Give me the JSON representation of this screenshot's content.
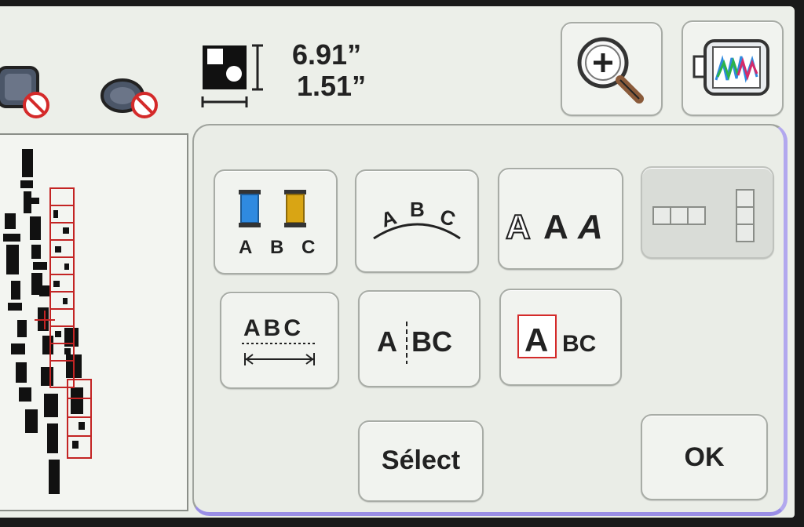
{
  "size": {
    "width": "6.91”",
    "height": "1.51”"
  },
  "buttons": {
    "select_label": "Sélect",
    "ok_label": "OK"
  },
  "icons": {
    "frame_no": "frame-no-icon",
    "oval_no": "oval-frame-no-icon",
    "size_indicator": "pattern-size-icon",
    "zoom": "zoom-in-icon",
    "embroidery": "embroidery-frame-icon",
    "thread_color": "thread-color-abc-icon",
    "arc_text": "arc-text-abc-icon",
    "font_style": "font-style-aaa-icon",
    "array": "array-layout-icon",
    "spacing": "letter-spacing-abc-icon",
    "split": "split-letters-abc-icon",
    "single_letter": "single-letter-abc-icon"
  },
  "colors": {
    "thread_blue": "#2f8ae0",
    "thread_gold": "#d9a514",
    "accent_red": "#d42a2a",
    "panel_border_purple": "#9a8ee6"
  },
  "glyphs": {
    "thread_a": "A",
    "thread_b": "B",
    "thread_c": "C",
    "arc_a": "A",
    "arc_b": "B",
    "arc_c": "C",
    "spacing_text": "ABC",
    "split_a": "A",
    "split_bc": "BC",
    "single_a": "A",
    "single_bc": "BC",
    "font_1": "A",
    "font_2": "A",
    "font_3": "A"
  }
}
